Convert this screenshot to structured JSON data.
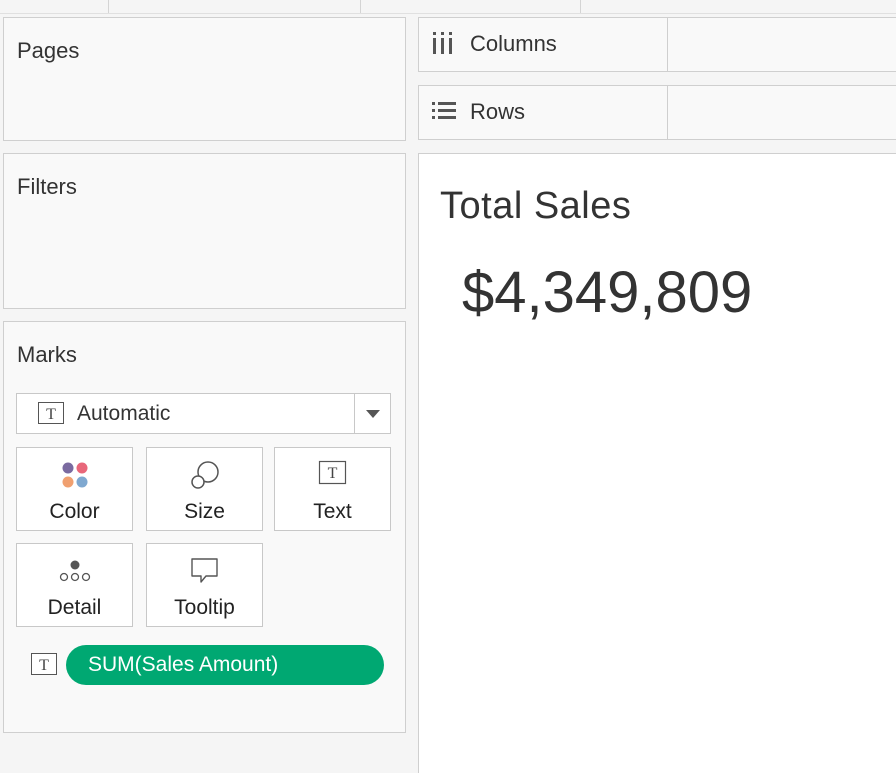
{
  "shelves": {
    "pages": {
      "label": "Pages"
    },
    "filters": {
      "label": "Filters"
    },
    "columns": {
      "label": "Columns"
    },
    "rows": {
      "label": "Rows"
    }
  },
  "marks": {
    "title": "Marks",
    "mark_type": "Automatic",
    "buttons": [
      {
        "label": "Color"
      },
      {
        "label": "Size"
      },
      {
        "label": "Text"
      },
      {
        "label": "Detail"
      },
      {
        "label": "Tooltip"
      }
    ],
    "fields": [
      {
        "icon": "text-icon",
        "label": "SUM(Sales Amount)",
        "color": "#00a872"
      }
    ]
  },
  "view": {
    "title": "Total Sales",
    "value": "$4,349,809"
  },
  "colors": {
    "pill_green": "#00a872",
    "color_dots": [
      "#7a6aa0",
      "#e8677a",
      "#f0a070",
      "#7fa8d0"
    ]
  }
}
